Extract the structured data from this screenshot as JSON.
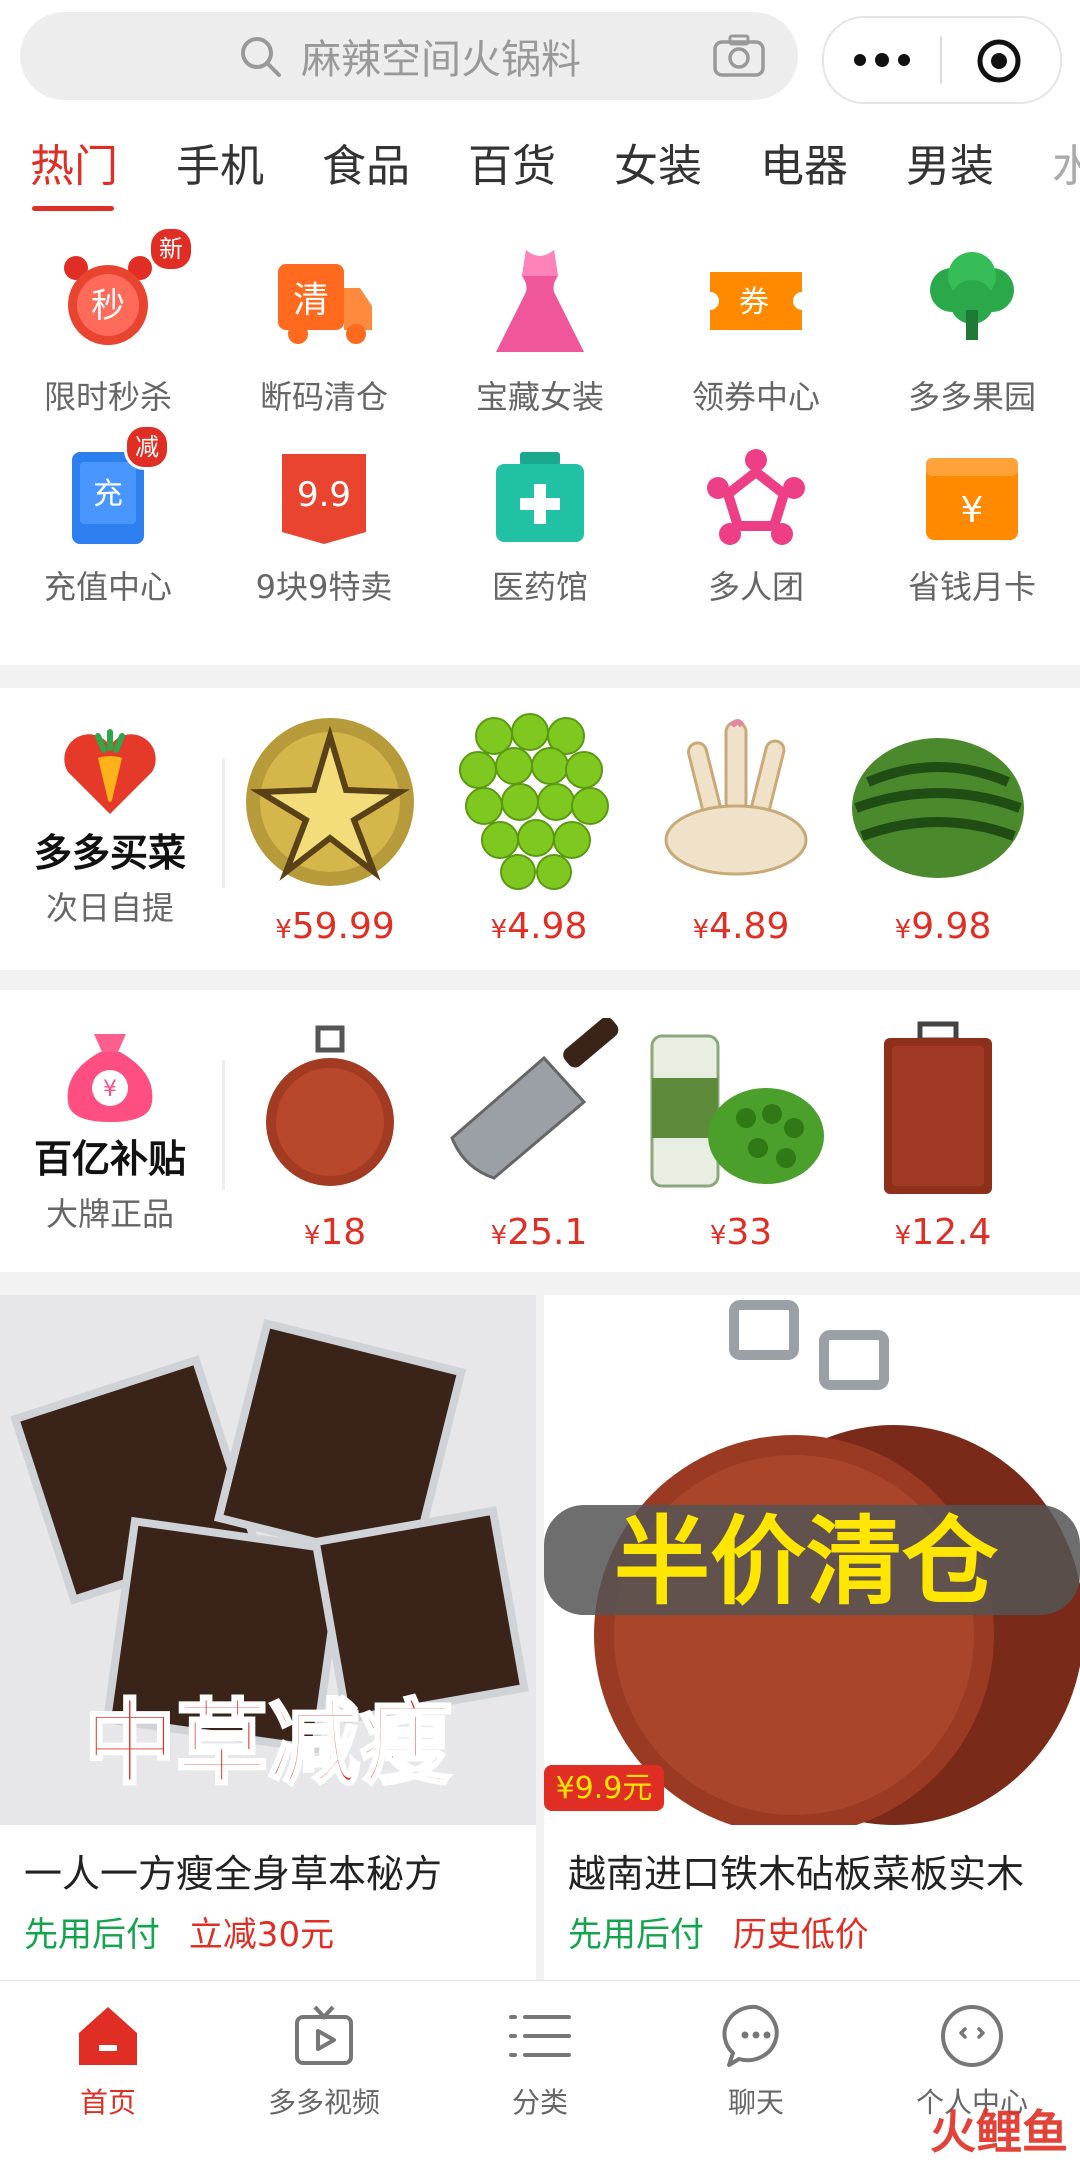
{
  "search": {
    "placeholder": "麻辣空间火锅料"
  },
  "tabs": [
    "热门",
    "手机",
    "食品",
    "百货",
    "女装",
    "电器",
    "男装",
    "水"
  ],
  "icon_grid": [
    {
      "label": "限时秒杀",
      "icon": "flash-sale-icon",
      "badge": "新",
      "glyph": "秒"
    },
    {
      "label": "断码清仓",
      "icon": "clearance-truck-icon",
      "glyph": "清"
    },
    {
      "label": "宝藏女装",
      "icon": "dress-icon"
    },
    {
      "label": "领券中心",
      "icon": "coupon-icon",
      "glyph": "券"
    },
    {
      "label": "多多果园",
      "icon": "orchard-tree-icon"
    },
    {
      "label": "充值中心",
      "icon": "recharge-icon",
      "badge": "减",
      "glyph": "充"
    },
    {
      "label": "9块9特卖",
      "icon": "nine-nine-icon",
      "glyph": "9.9"
    },
    {
      "label": "医药馆",
      "icon": "medicine-box-icon"
    },
    {
      "label": "多人团",
      "icon": "group-buy-icon"
    },
    {
      "label": "省钱月卡",
      "icon": "monthly-card-icon",
      "glyph": "¥"
    }
  ],
  "maicai": {
    "title": "多多买菜",
    "subtitle": "次日自提",
    "products": [
      {
        "name": "durian",
        "price": "59.99"
      },
      {
        "name": "grapes",
        "price": "4.98"
      },
      {
        "name": "ginger",
        "price": "4.89"
      },
      {
        "name": "watermelon",
        "price": "9.98"
      }
    ]
  },
  "subsidy": {
    "title": "百亿补贴",
    "subtitle": "大牌正品",
    "products": [
      {
        "name": "round-cutting-board",
        "price": "18"
      },
      {
        "name": "cleaver",
        "price": "25.1"
      },
      {
        "name": "green-tea-jar",
        "price": "33"
      },
      {
        "name": "square-cutting-board",
        "price": "12.4"
      }
    ]
  },
  "currency": "¥",
  "feed": [
    {
      "banner": "中草减瘦",
      "title": "一人一方瘦全身草本秘方",
      "tag1": "先用后付",
      "tag2": "立减30元"
    },
    {
      "banner": "半价清仓",
      "badge": "¥9.9元",
      "title": "越南进口铁木砧板菜板实木",
      "tag1": "先用后付",
      "tag2": "历史低价"
    }
  ],
  "bottom_nav": [
    {
      "label": "首页",
      "icon": "home-icon",
      "active": true
    },
    {
      "label": "多多视频",
      "icon": "video-icon"
    },
    {
      "label": "分类",
      "icon": "category-list-icon"
    },
    {
      "label": "聊天",
      "icon": "chat-icon"
    },
    {
      "label": "个人中心",
      "icon": "profile-icon"
    }
  ],
  "watermark": "火鲤鱼",
  "colors": {
    "accent": "#e02e24",
    "green": "#14a44d"
  }
}
